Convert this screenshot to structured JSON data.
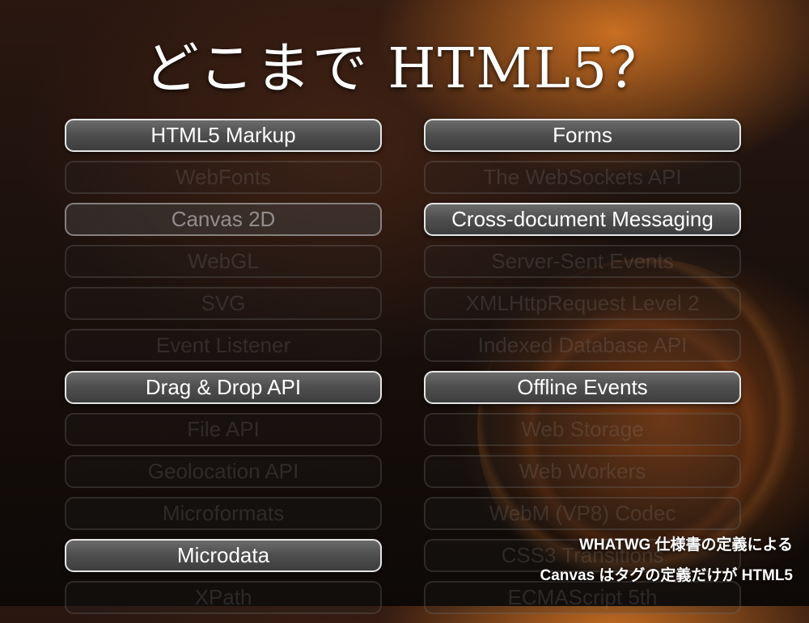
{
  "title": "どこまで HTML5？",
  "left_column": [
    {
      "label": "HTML5 Markup",
      "state": "active"
    },
    {
      "label": "WebFonts",
      "state": "faded"
    },
    {
      "label": "Canvas 2D",
      "state": "semi"
    },
    {
      "label": "WebGL",
      "state": "faded"
    },
    {
      "label": "SVG",
      "state": "faded"
    },
    {
      "label": "Event Listener",
      "state": "faded"
    },
    {
      "label": "Drag & Drop API",
      "state": "active"
    },
    {
      "label": "File API",
      "state": "faded"
    },
    {
      "label": "Geolocation API",
      "state": "faded"
    },
    {
      "label": "Microformats",
      "state": "faded"
    },
    {
      "label": "Microdata",
      "state": "active"
    },
    {
      "label": "XPath",
      "state": "faded"
    }
  ],
  "right_column": [
    {
      "label": "Forms",
      "state": "active"
    },
    {
      "label": "The WebSockets API",
      "state": "faded"
    },
    {
      "label": "Cross-document Messaging",
      "state": "active"
    },
    {
      "label": "Server-Sent Events",
      "state": "faded"
    },
    {
      "label": "XMLHttpRequest Level 2",
      "state": "faded"
    },
    {
      "label": "Indexed Database API",
      "state": "faded"
    },
    {
      "label": "Offline Events",
      "state": "active"
    },
    {
      "label": "Web Storage",
      "state": "faded"
    },
    {
      "label": "Web Workers",
      "state": "faded"
    },
    {
      "label": "WebM (VP8) Codec",
      "state": "faded"
    },
    {
      "label": "CSS3 Transitions",
      "state": "faded"
    },
    {
      "label": "ECMAScript 5th",
      "state": "faded"
    }
  ],
  "note": {
    "line1": "WHATWG 仕様書の定義による",
    "line2": "Canvas はタグの定義だけが HTML5"
  },
  "colors": {
    "active_fill": "#555555",
    "active_border": "#e6e6e6",
    "text": "#ffffff",
    "background": "#120c09",
    "accent_glow": "#ff8c28"
  }
}
